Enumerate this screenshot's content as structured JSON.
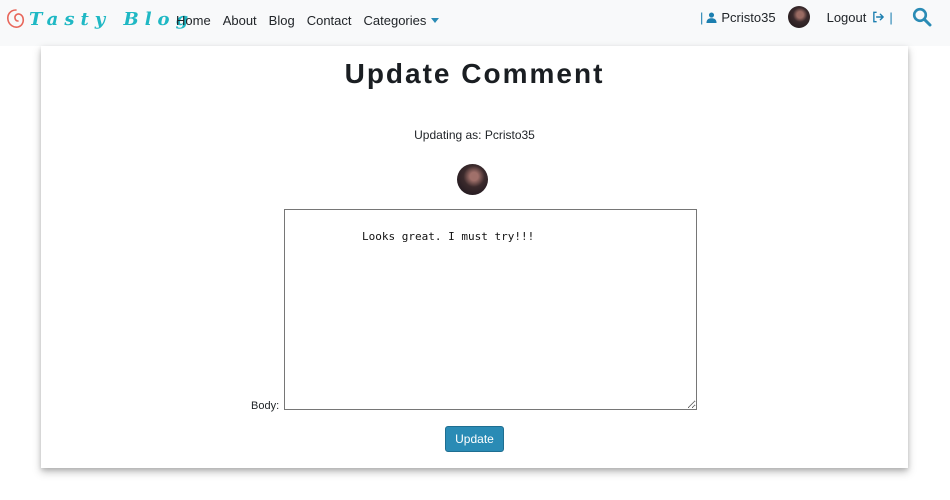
{
  "brand": {
    "name": "Tasty Blog",
    "logo_icon": "swirl-logo-icon"
  },
  "nav": {
    "items": [
      {
        "label": "Home"
      },
      {
        "label": "About"
      },
      {
        "label": "Blog"
      },
      {
        "label": "Contact"
      },
      {
        "label": "Categories",
        "has_dropdown": true
      }
    ]
  },
  "user": {
    "separator": "|",
    "username": "Pcristo35",
    "logout_label": "Logout",
    "user_icon": "user-icon",
    "logout_icon": "sign-out-icon",
    "search_icon": "search-icon"
  },
  "page": {
    "title": "Update Comment",
    "updating_as": "Updating as: Pcristo35",
    "body_label": "Body:",
    "body_value": "Looks great. I must try!!!",
    "submit_label": "Update"
  },
  "colors": {
    "brand": "#1fb8c4",
    "accent": "#2a8bb5",
    "navbar_bg": "#f8f9fa"
  }
}
